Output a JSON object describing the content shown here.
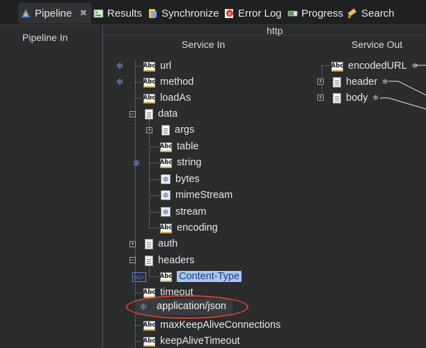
{
  "tabs": [
    {
      "label": "Pipeline",
      "icon": "pipeline-icon",
      "active": true
    },
    {
      "label": "Results",
      "icon": "results-icon"
    },
    {
      "label": "Synchronize",
      "icon": "synchronize-icon"
    },
    {
      "label": "Error Log",
      "icon": "error-log-icon"
    },
    {
      "label": "Progress",
      "icon": "progress-icon"
    },
    {
      "label": "Search",
      "icon": "search-icon"
    }
  ],
  "panes": {
    "pipeline_in": "Pipeline In",
    "service_name": "http",
    "service_in": "Service In",
    "service_out": "Service Out"
  },
  "service_in_fields": {
    "url": "url",
    "method": "method",
    "loadAs": "loadAs",
    "data": "data",
    "args": "args",
    "table": "table",
    "string": "string",
    "bytes": "bytes",
    "mimeStream": "mimeStream",
    "stream": "stream",
    "encoding": "encoding",
    "auth": "auth",
    "headers": "headers",
    "content_type": "Content-Type",
    "timeout": "timeout",
    "maxKeepAliveConnections": "maxKeepAliveConnections",
    "keepAliveTimeout": "keepAliveTimeout"
  },
  "service_out_fields": {
    "encodedURL": "encodedURL",
    "header": "header",
    "body": "body"
  },
  "tooltip": {
    "value": "application/json"
  },
  "colors": {
    "highlight": "#d4452e",
    "selection": "#a9c6f4",
    "background": "#2b2c2e"
  }
}
